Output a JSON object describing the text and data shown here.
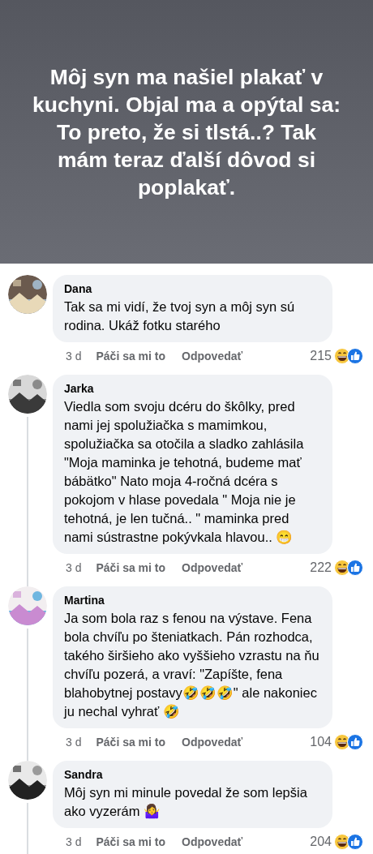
{
  "post": {
    "text": "Môj syn ma našiel plakať v kuchyni. Objal ma a opýtal sa: To preto, že si tlstá..? Tak mám teraz ďalší dôvod si poplakať."
  },
  "comments": [
    {
      "author": "Dana",
      "text": "Tak sa mi vidí, že tvoj syn a môj syn sú rodina. Ukáž fotku starého",
      "time": "3 d",
      "like_label": "Páči sa mi to",
      "reply_label": "Odpovedať",
      "reaction_count": "215",
      "has_replies": false
    },
    {
      "author": "Jarka",
      "text": "Viedla som svoju dcéru do škôlky, pred nami jej spolužiačka s mamimkou, spolužiačka sa otočila a sladko zahlásila \"Moja maminka je tehotná, budeme mať bábätko\" Nato moja 4-ročná dcéra s pokojom v hlase povedala \" Moja nie je tehotná, je len tučná.. \" maminka pred nami sústrastne pokývkala hlavou.. 😁",
      "time": "3 d",
      "like_label": "Páči sa mi to",
      "reply_label": "Odpovedať",
      "reaction_count": "222",
      "has_replies": true
    },
    {
      "author": "Martina",
      "text": "Ja som bola raz s fenou na výstave. Fena bola chvíľu po šteniatkach. Pán rozhodca, takého širšieho ako vyššieho vzrastu na ňu chvíľu pozerá, a vraví: \"Zapíšte, fena blahobytnej postavy🤣🤣🤣\" ale nakoniec ju nechal vyhrať 🤣",
      "time": "3 d",
      "like_label": "Páči sa mi to",
      "reply_label": "Odpovedať",
      "reaction_count": "104",
      "has_replies": true
    },
    {
      "author": "Sandra",
      "text": "Môj syn mi minule povedal že som lepšia ako vyzerám 🤷‍♀️",
      "time": "3 d",
      "like_label": "Páči sa mi to",
      "reply_label": "Odpovedať",
      "reaction_count": "204",
      "has_replies": true
    }
  ]
}
